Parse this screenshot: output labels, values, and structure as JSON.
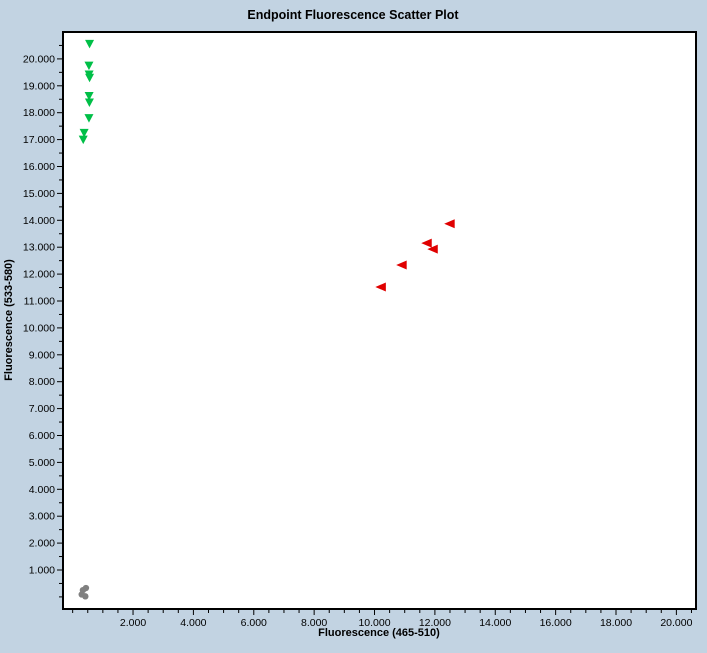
{
  "window": {
    "background_color": "#c2d3e2"
  },
  "chart_data": {
    "type": "scatter",
    "title": "Endpoint Fluorescence Scatter Plot",
    "xlabel": "Fluorescence (465-510)",
    "ylabel": "Fluorescence (533-580)",
    "xlim": [
      -320,
      20650
    ],
    "ylim": [
      -450,
      21000
    ],
    "x_ticks": {
      "minor_step": 500,
      "label_step": 2000,
      "label_min": 2000,
      "label_max": 20000,
      "tick_min": 0,
      "tick_max": 20500
    },
    "y_ticks": {
      "minor_step": 500,
      "label_step": 1000,
      "label_min": 1000,
      "label_max": 20000,
      "tick_min": 0,
      "tick_max": 20500
    },
    "tick_label_style": "thousands-with-dot (e.g. 2.000 = 2000)",
    "grid": false,
    "legend": false,
    "colors": {
      "background": "#c2d3e2",
      "plot_background": "#ffffff",
      "plot_border": "#000000",
      "text": "#000000"
    },
    "series": [
      {
        "name": "green-triangles",
        "marker": "triangle-down",
        "color": "#00bf47",
        "points": [
          [
            560,
            20560
          ],
          [
            540,
            19750
          ],
          [
            545,
            19420
          ],
          [
            560,
            19300
          ],
          [
            545,
            18620
          ],
          [
            555,
            18380
          ],
          [
            540,
            17800
          ],
          [
            380,
            17250
          ],
          [
            350,
            17000
          ]
        ]
      },
      {
        "name": "red-triangles",
        "marker": "triangle-left",
        "color": "#e00000",
        "points": [
          [
            12490,
            13870
          ],
          [
            11730,
            13150
          ],
          [
            11930,
            12930
          ],
          [
            10900,
            12340
          ],
          [
            10210,
            11520
          ]
        ]
      },
      {
        "name": "gray-dots",
        "marker": "circle",
        "color": "#808080",
        "points": [
          [
            440,
            330
          ],
          [
            340,
            250
          ],
          [
            300,
            90
          ],
          [
            420,
            20
          ]
        ]
      }
    ]
  }
}
